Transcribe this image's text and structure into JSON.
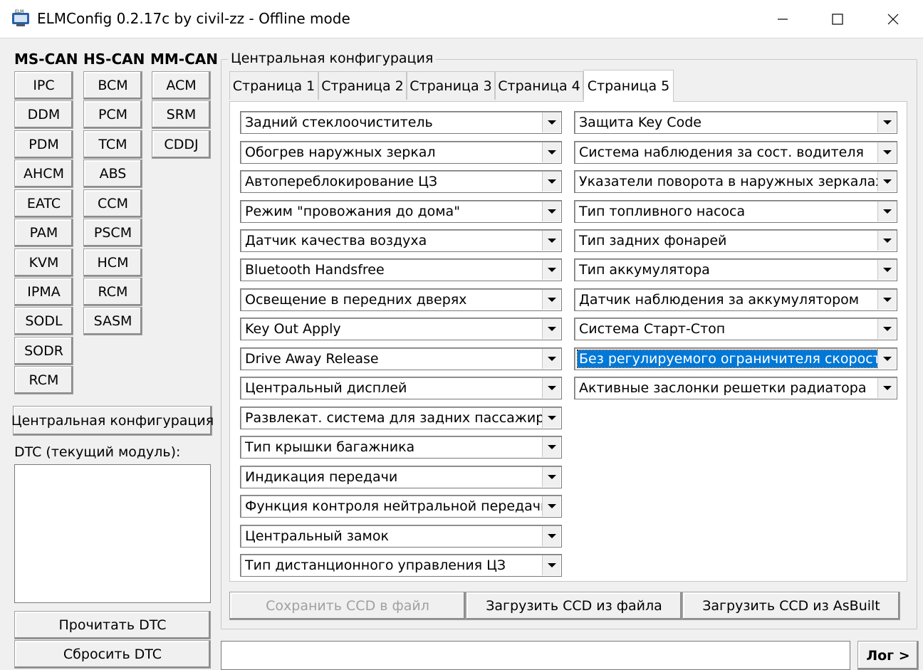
{
  "window": {
    "title": "ELMConfig 0.2.17c by civil-zz - Offline mode",
    "icon": "elmconfig-app-icon",
    "minimize_icon": "minimize-icon",
    "maximize_icon": "maximize-icon",
    "close_icon": "close-icon"
  },
  "modules": {
    "ms_can": {
      "label": "MS-CAN",
      "items": [
        "IPC",
        "DDM",
        "PDM",
        "AHCM",
        "EATC",
        "PAM",
        "KVM",
        "IPMA",
        "SODL",
        "SODR",
        "RCM"
      ]
    },
    "hs_can": {
      "label": "HS-CAN",
      "items": [
        "BCM",
        "PCM",
        "TCM",
        "ABS",
        "CCM",
        "PSCM",
        "HCM",
        "RCM",
        "SASM"
      ]
    },
    "mm_can": {
      "label": "MM-CAN",
      "items": [
        "ACM",
        "SRM",
        "CDDJ"
      ]
    }
  },
  "sidebar": {
    "central_config_button": "Центральная конфигурация",
    "dtc_label": "DTC (текущий модуль):",
    "read_dtc_button": "Прочитать DTC",
    "reset_dtc_button": "Сбросить DTC"
  },
  "config": {
    "group_title": "Центральная конфигурация",
    "tabs": [
      "Страница 1",
      "Страница 2",
      "Страница 3",
      "Страница 4",
      "Страница 5"
    ],
    "active_tab": "Страница 5",
    "left_column": [
      "Задний стеклоочиститель",
      "Обогрев наружных зеркал",
      "Автоперeблокирование ЦЗ",
      "Режим \"провожания до дома\"",
      "Датчик качества воздуха",
      "Bluetooth Handsfree",
      "Освещение в передних дверях",
      "Key Out Apply",
      "Drive Away Release",
      "Центральный дисплей",
      "Развлекат. система для задних пассажиров",
      "Тип крышки багажника",
      "Индикация передачи",
      "Функция контроля нейтральной передачи",
      "Центральный замок",
      "Тип дистанционного управления ЦЗ"
    ],
    "right_column": [
      "Защита Key Code",
      "Система наблюдения за сост. водителя",
      "Указатели поворота в наружных зеркалах",
      "Тип топливного насоса",
      "Тип задних фонарей",
      "Тип аккумулятора",
      "Датчик наблюдения за аккумулятором",
      "Система Старт-Стоп",
      "Без регулируемого ограничителя скорости",
      "Активные заслонки решетки радиатора"
    ],
    "selected_item": "Без регулируемого ограничителя скорости",
    "dropdown_icon": "chevron-down-icon",
    "buttons": {
      "save": "Сохранить CCD в файл",
      "load_file": "Загрузить CCD из файла",
      "load_asbuilt": "Загрузить CCD из AsBuilt"
    }
  },
  "status": {
    "text": "",
    "log_button": "Лог >"
  },
  "colors": {
    "selection": "#0078d7",
    "window_bg": "#f0f0f0"
  }
}
